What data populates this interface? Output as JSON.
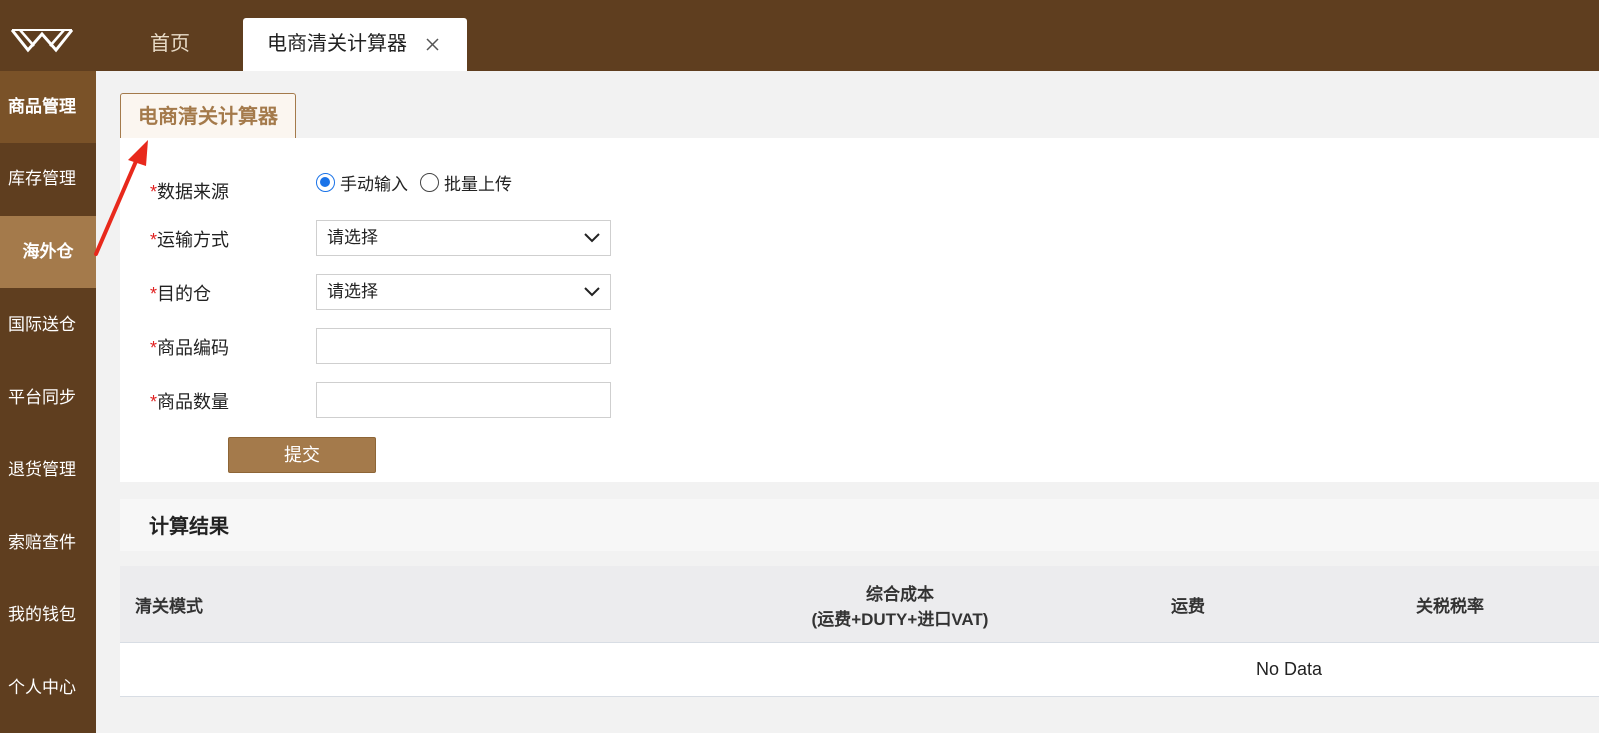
{
  "header": {
    "logo_icon": "brand-w-logo-icon",
    "tabs": [
      {
        "label": "首页"
      },
      {
        "label": "电商清关计算器",
        "closable": true
      }
    ]
  },
  "sidebar": {
    "items": [
      {
        "label": "商品管理"
      },
      {
        "label": "库存管理"
      },
      {
        "label": "海外仓",
        "active": true
      },
      {
        "label": "国际送仓"
      },
      {
        "label": "平台同步"
      },
      {
        "label": "退货管理"
      },
      {
        "label": "索赔查件"
      },
      {
        "label": "我的钱包"
      },
      {
        "label": "个人中心"
      }
    ]
  },
  "form": {
    "tab_label": "电商清关计算器",
    "required_mark": "*",
    "source": {
      "label": "数据来源",
      "options": [
        {
          "label": "手动输入",
          "selected": true
        },
        {
          "label": "批量上传",
          "selected": false
        }
      ]
    },
    "transport": {
      "label": "运输方式",
      "value": "请选择"
    },
    "warehouse": {
      "label": "目的仓",
      "value": "请选择"
    },
    "sku": {
      "label": "商品编码",
      "value": ""
    },
    "quantity": {
      "label": "商品数量",
      "value": ""
    },
    "submit_label": "提交"
  },
  "result": {
    "title": "计算结果",
    "columns": [
      "清关模式",
      "综合成本",
      "(运费+DUTY+进口VAT)",
      "运费",
      "关税税率"
    ],
    "empty_text": "No Data"
  },
  "colors": {
    "brand_dark": "#5f3e1f",
    "brand_accent": "#a47a4b",
    "required": "#e02020",
    "radio_selected": "#1a73e8",
    "annotation_arrow": "#e8291c"
  }
}
